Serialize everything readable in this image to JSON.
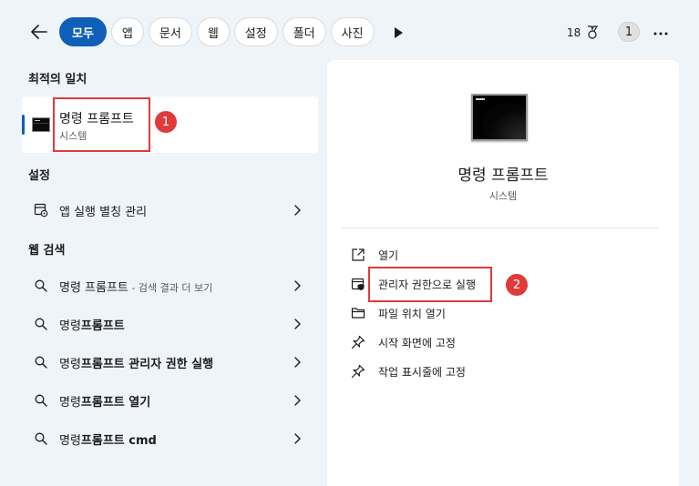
{
  "header": {
    "filters": [
      "모두",
      "앱",
      "문서",
      "웹",
      "설정",
      "폴더",
      "사진"
    ],
    "points": "18",
    "account_badge": "1"
  },
  "sections": {
    "best_match": "최적의 일치",
    "settings": "설정",
    "web_search": "웹 검색"
  },
  "best_match": {
    "title": "명령 프롬프트",
    "subtitle": "시스템"
  },
  "settings_items": [
    {
      "label": "앱 실행 별칭 관리"
    }
  ],
  "web_items": [
    {
      "normal": "명령 프롬프트",
      "bold": "",
      "hint": " - 검색 결과 더 보기"
    },
    {
      "normal": "명령",
      "bold": "프롬프트",
      "hint": ""
    },
    {
      "normal": "명령",
      "bold": "프롬프트 관리자 권한 실행",
      "hint": ""
    },
    {
      "normal": "명령",
      "bold": "프롬프트 열기",
      "hint": ""
    },
    {
      "normal": "명령",
      "bold": "프롬프트 cmd",
      "hint": ""
    }
  ],
  "detail": {
    "title": "명령 프롬프트",
    "subtitle": "시스템",
    "actions": [
      {
        "label": "열기",
        "icon": "open-icon"
      },
      {
        "label": "관리자 권한으로 실행",
        "icon": "admin-shield-icon"
      },
      {
        "label": "파일 위치 열기",
        "icon": "folder-icon"
      },
      {
        "label": "시작 화면에 고정",
        "icon": "pin-icon"
      },
      {
        "label": "작업 표시줄에 고정",
        "icon": "pin-icon"
      }
    ]
  },
  "annotations": {
    "marker_1": "1",
    "marker_2": "2"
  },
  "colors": {
    "accent": "#0f5fb8",
    "highlight": "#e33a3a"
  }
}
